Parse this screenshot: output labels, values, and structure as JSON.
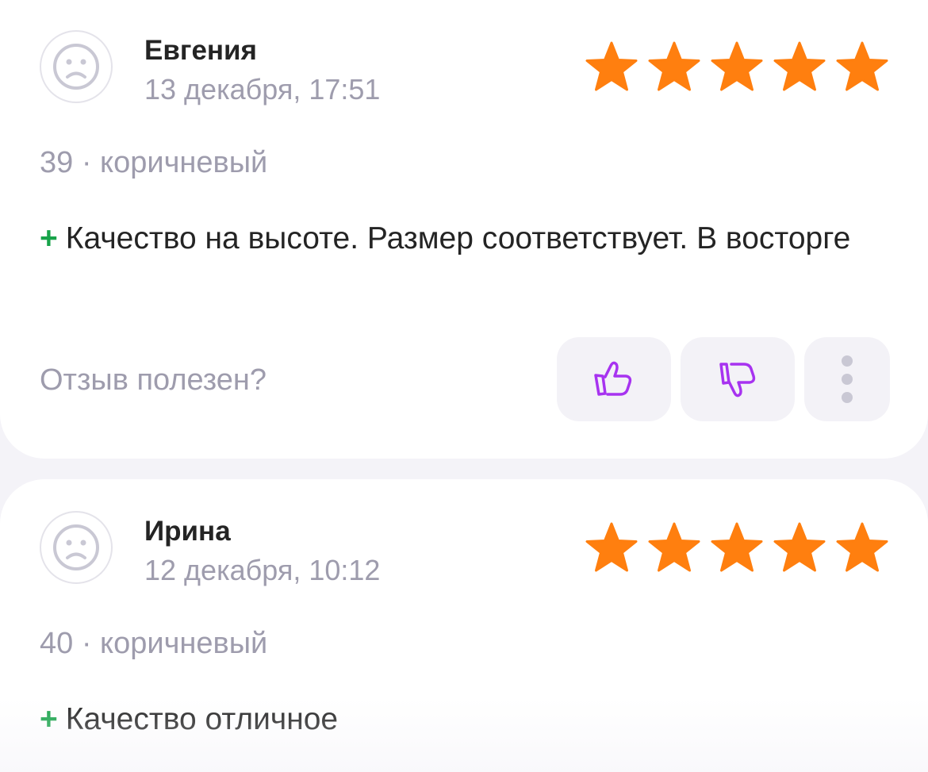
{
  "reviews": [
    {
      "author": "Евгения",
      "date": "13 декабря, 17:51",
      "rating": 5,
      "meta": "39 · коричневый",
      "plus_mark": "+",
      "text": "Качество на высоте. Размер соответствует. В восторге"
    },
    {
      "author": "Ирина",
      "date": "12 декабря, 10:12",
      "rating": 5,
      "meta": "40 · коричневый",
      "plus_mark": "+",
      "text": "Качество отличное"
    }
  ],
  "helpful_prompt": "Отзыв полезен?",
  "icons": {
    "avatar": "sad-face-icon",
    "star": "star-icon",
    "like": "thumbs-up-icon",
    "dislike": "thumbs-down-icon",
    "more": "more-vertical-icon"
  },
  "colors": {
    "star": "#ff7f0f",
    "accent": "#a733f0",
    "plus": "#18a34a",
    "muted_text": "#9e9cad",
    "background": "#f4f3f8"
  }
}
